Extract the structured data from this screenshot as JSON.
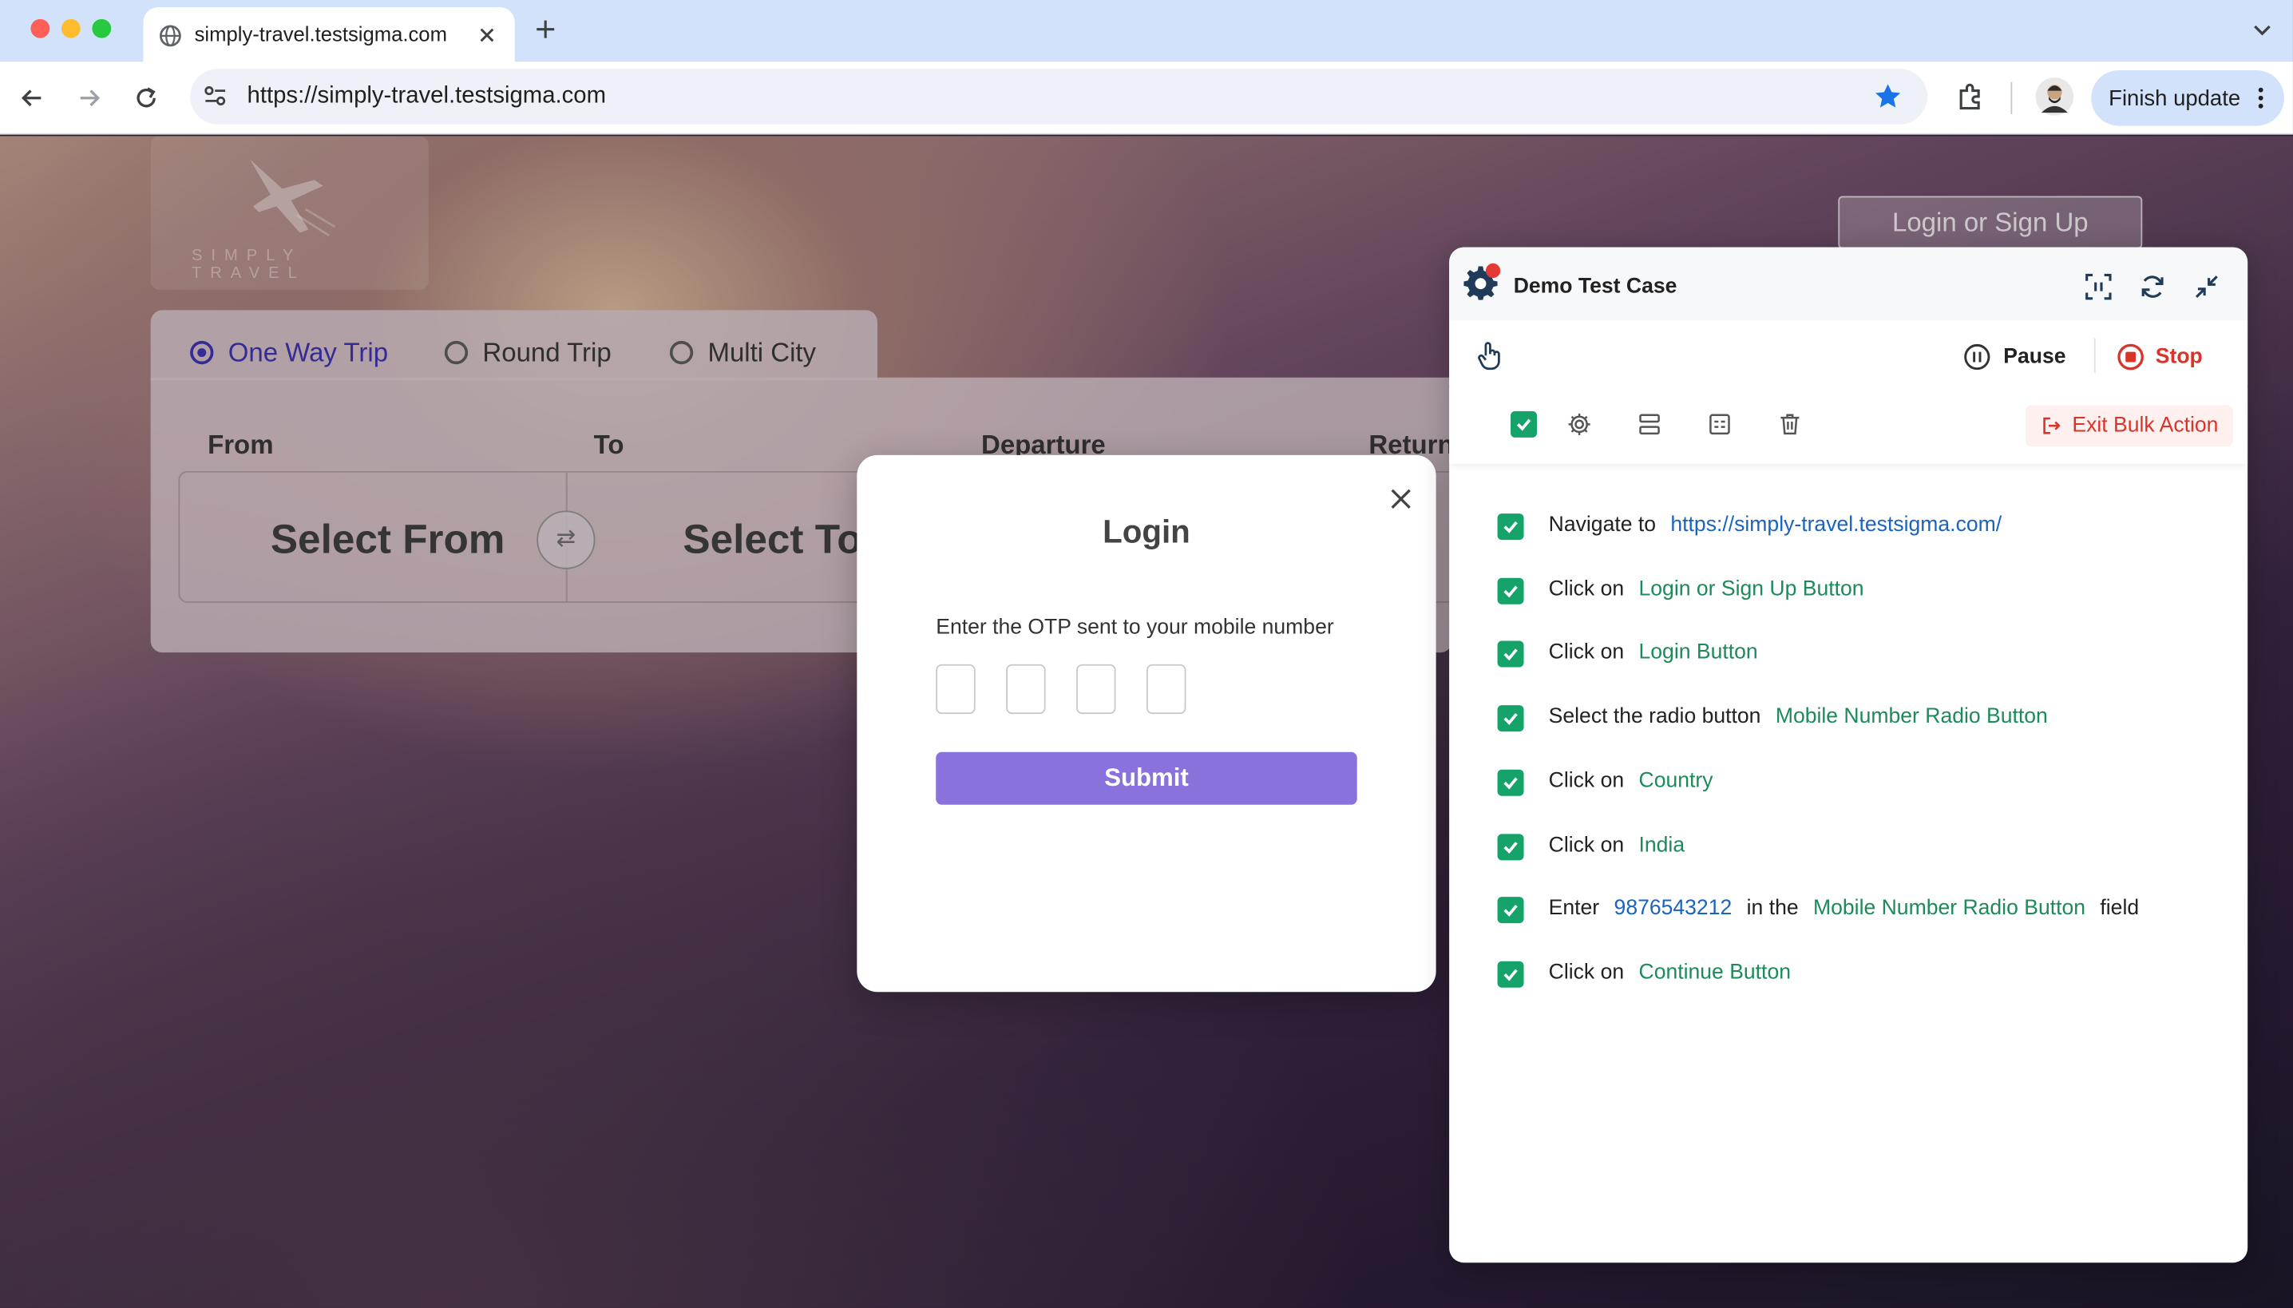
{
  "browser": {
    "tab_title": "simply-travel.testsigma.com",
    "url": "https://simply-travel.testsigma.com",
    "finish_update_label": "Finish update"
  },
  "site": {
    "logo_text": "SIMPLY TRAVEL",
    "login_signup_label": "Login or Sign Up",
    "trip_options": [
      "One Way Trip",
      "Round Trip",
      "Multi City"
    ],
    "selected_trip": "One Way Trip",
    "field_labels": {
      "from": "From",
      "to": "To",
      "departure": "Departure",
      "return": "Return"
    },
    "select_from": "Select From",
    "select_to": "Select To"
  },
  "login_modal": {
    "title": "Login",
    "otp_prompt": "Enter the OTP sent to your mobile number",
    "otp_digits": [
      "",
      "",
      "",
      ""
    ],
    "submit_label": "Submit"
  },
  "test_panel": {
    "title": "Demo Test Case",
    "pause_label": "Pause",
    "stop_label": "Stop",
    "exit_bulk_label": "Exit Bulk Action",
    "colors": {
      "check": "#16a36a",
      "element": "#1d8a5a",
      "url": "#1a64c0",
      "stop": "#d9342b"
    },
    "steps": [
      {
        "action": "Navigate to",
        "target": "https://simply-travel.testsigma.com/"
      },
      {
        "action": "Click on",
        "target": "Login or Sign Up Button"
      },
      {
        "action": "Click on",
        "target": "Login Button"
      },
      {
        "action": "Select the radio button",
        "target": "Mobile Number Radio Button"
      },
      {
        "action": "Click on",
        "target": "Country"
      },
      {
        "action": "Click on",
        "target": "India"
      },
      {
        "action": "Enter",
        "value": "9876543212",
        "mid": "in the",
        "target": "Mobile Number Radio Button",
        "suffix": "field"
      },
      {
        "action": "Click on",
        "target": "Continue Button"
      }
    ]
  }
}
